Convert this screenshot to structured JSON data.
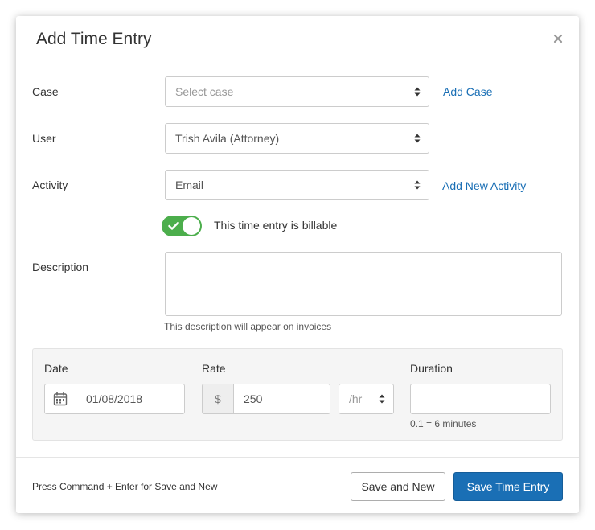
{
  "modal": {
    "title": "Add Time Entry"
  },
  "form": {
    "case_label": "Case",
    "case_placeholder": "Select case",
    "add_case_link": "Add Case",
    "user_label": "User",
    "user_value": "Trish Avila (Attorney)",
    "activity_label": "Activity",
    "activity_value": "Email",
    "add_activity_link": "Add New Activity",
    "billable_label": "This time entry is billable",
    "billable_on": true,
    "description_label": "Description",
    "description_value": "",
    "description_help": "This description will appear on invoices"
  },
  "entry": {
    "date_label": "Date",
    "date_value": "01/08/2018",
    "rate_label": "Rate",
    "rate_prefix": "$",
    "rate_value": "250",
    "rate_unit": "/hr",
    "duration_label": "Duration",
    "duration_value": "",
    "duration_help": "0.1 = 6 minutes"
  },
  "footer": {
    "hint": "Press Command + Enter for Save and New",
    "save_new_label": "Save and New",
    "save_label": "Save Time Entry"
  },
  "colors": {
    "primary": "#1a6fb5",
    "toggle_on": "#4cae4c",
    "link": "#1a6fb5"
  }
}
